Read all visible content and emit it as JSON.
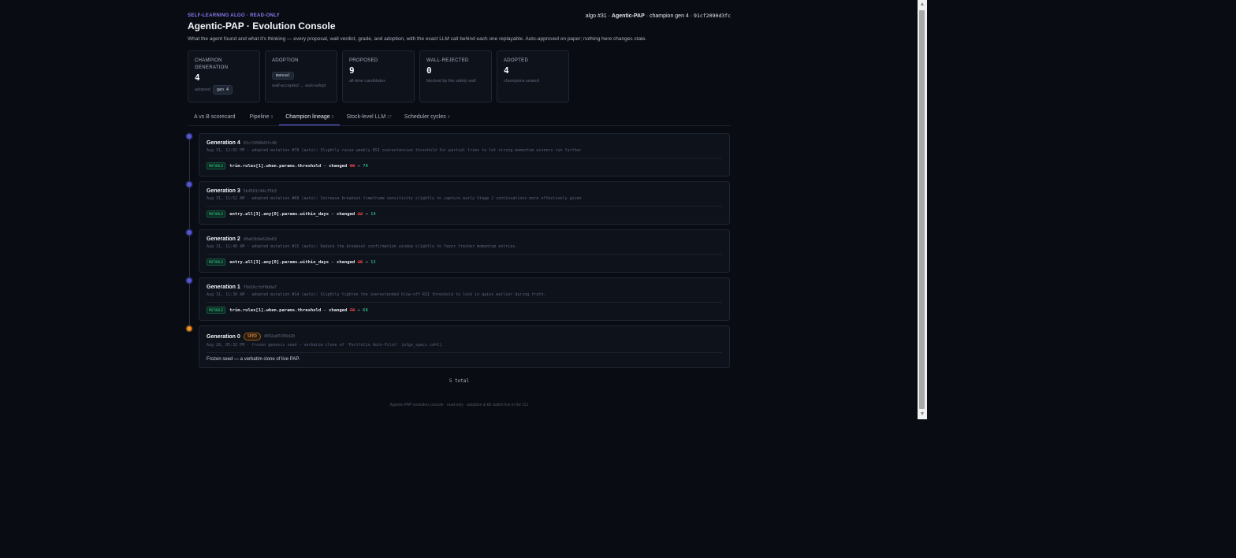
{
  "header": {
    "eyebrow": "SELF-LEARNING ALGO · READ-ONLY",
    "crumb_prefix": "algo #31 · ",
    "crumb_name": "Agentic-PAP",
    "crumb_mid": " · champion gen 4 · ",
    "crumb_hash": "91cf2090d3fc",
    "title": "Agentic-PAP · Evolution Console",
    "subtitle": "What the agent found and what it's thinking — every proposal, wall verdict, grade, and adoption, with the exact LLM call behind each one replayable. Auto-approved on paper; nothing here changes state."
  },
  "stats": [
    {
      "label": "CHAMPION GENERATION",
      "value": "4",
      "sub": "adopted",
      "pill": "gen 4"
    },
    {
      "label": "ADOPTION",
      "pill": "manual",
      "value": "",
      "sub": "wall-accepted → auto-adopt"
    },
    {
      "label": "PROPOSED",
      "value": "9",
      "sub": "all-time candidates"
    },
    {
      "label": "WALL-REJECTED",
      "value": "0",
      "sub": "blocked by the safety wall"
    },
    {
      "label": "ADOPTED",
      "value": "4",
      "sub": "champions seated"
    }
  ],
  "tabs": [
    {
      "label": "A vs B scorecard",
      "count": ""
    },
    {
      "label": "Pipeline",
      "count": "9"
    },
    {
      "label": "Champion lineage",
      "count": "5"
    },
    {
      "label": "Stock-level LLM",
      "count": "17"
    },
    {
      "label": "Scheduler cycles",
      "count": "4"
    }
  ],
  "active_tab": "Champion lineage",
  "lineage": [
    {
      "title": "Generation 4",
      "hash": "91cf2090d3fc48",
      "meta": "Aug 31, 12:02 PM · adopted mutation #78 (auto): Slightly raise weekly RSI overextension threshold for partial trims to let strong momentum winners run further",
      "badge": "MUTABLE",
      "path": "trim.rules[1].when.params.threshold",
      "changed": "changed",
      "old": "68",
      "new": "70"
    },
    {
      "title": "Generation 3",
      "hash": "5b4501f44c75b3",
      "meta": "Aug 31, 11:52 AM · adopted mutation #68 (auto): Increase breakout timeframe sensitivity slightly to capture early Stage 2 continuations more effectively given",
      "badge": "MUTABLE",
      "path": "entry.all[3].any[0].params.within_days",
      "changed": "changed",
      "old": "12",
      "new": "14"
    },
    {
      "title": "Generation 2",
      "hash": "d0a63b9e616e63",
      "meta": "Aug 31, 11:40 AM · adopted mutation #15 (auto): Reduce the breakout confirmation window slightly to favor fresher momentum entries.",
      "badge": "MUTABLE",
      "path": "entry.all[3].any[0].params.within_days",
      "changed": "changed",
      "old": "15",
      "new": "12"
    },
    {
      "title": "Generation 1",
      "hash": "f9d16cfdf6b0a7",
      "meta": "Aug 31, 11:30 AM · adopted mutation #14 (auto): Slightly tighten the overextended blow-off RSI threshold to lock in gains earlier during froth.",
      "badge": "MUTABLE",
      "path": "trim.rules[1].when.params.threshold",
      "changed": "changed",
      "old": "70",
      "new": "68"
    },
    {
      "title": "Generation 0",
      "hash": "4032a65309d20",
      "seed_badge": "SEED",
      "meta": "Aug 28, 05:32 PM · frozen genesis seed — verbatim clone of 'Portfolio Auto-Pilot' (algo_specs id=1).",
      "text": "Frozen seed — a verbatim clone of live PAP."
    }
  ],
  "total": "5 total",
  "footer": "Agentic-PAP evolution console · read-only · adoption & kill switch live in the CLI",
  "colors": {
    "accent": "#6366f1",
    "seed": "#f0932b",
    "new_value": "#34d399",
    "old_value": "#ef4444"
  }
}
